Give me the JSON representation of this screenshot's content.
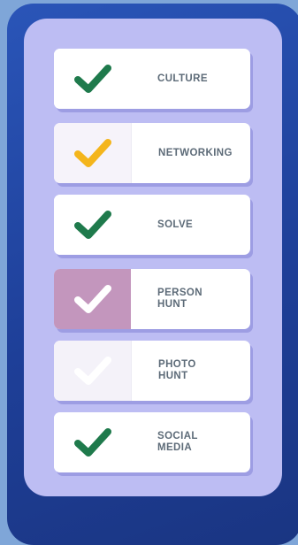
{
  "colors": {
    "background": "#7fa6d8",
    "frame": "#2148a8",
    "panel": "#bdbdf3",
    "card": "#ffffff",
    "label": "#5d6b78",
    "check_green": "#1f7a4c",
    "check_orange": "#f4b51c",
    "check_white": "#ffffff",
    "person_hunt_bg": "#c396bd",
    "tinted_bg": "#f5f3fa"
  },
  "items": [
    {
      "label": "CULTURE",
      "icon": "check-icon",
      "check_color": "#1f7a4c",
      "icon_bg": "#ffffff"
    },
    {
      "label": "NETWORKING",
      "icon": "check-icon",
      "check_color": "#f4b51c",
      "icon_bg": "#f6f3fa"
    },
    {
      "label": "SOLVE",
      "icon": "check-icon",
      "check_color": "#1f7a4c",
      "icon_bg": "#ffffff"
    },
    {
      "label": "PERSON\nHUNT",
      "icon": "check-icon",
      "check_color": "#ffffff",
      "icon_bg": "#c396bd"
    },
    {
      "label": "PHOTO\nHUNT",
      "icon": "check-icon",
      "check_color": "#ffffff",
      "icon_bg": "#f4f2f9"
    },
    {
      "label": "SOCIAL\nMEDIA",
      "icon": "check-icon",
      "check_color": "#1f7a4c",
      "icon_bg": "#ffffff"
    }
  ]
}
